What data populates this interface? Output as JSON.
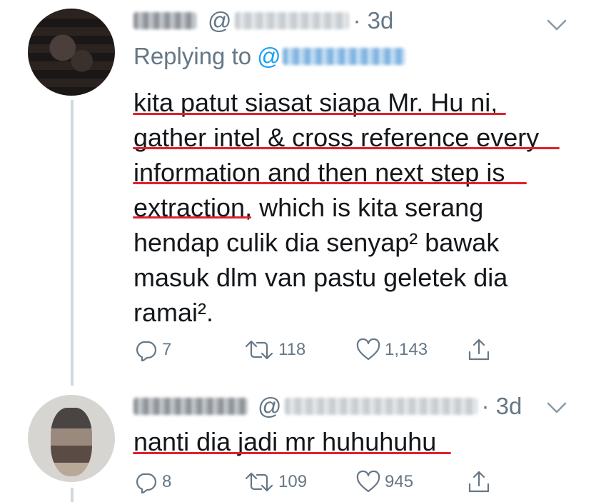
{
  "tweet1": {
    "handle_at": "@",
    "dot_time": "· 3d",
    "replying_label": "Replying to",
    "replying_at": "@",
    "lines": [
      "kita patut siasat siapa Mr. Hu ni,",
      "gather intel & cross reference every",
      "information and then next step is",
      "extraction, which is kita serang",
      "hendap culik dia senyap² bawak",
      "masuk dlm van pastu geletek dia",
      "ramai²."
    ],
    "replies": "7",
    "retweets": "118",
    "likes": "1,143"
  },
  "tweet2": {
    "handle_at": "@",
    "dot_time": "· 3d",
    "lines": [
      "nanti dia jadi mr huhuhuhu"
    ],
    "replies": "8",
    "retweets": "109",
    "likes": "945"
  },
  "icons": [
    "reply-icon",
    "retweet-icon",
    "like-icon",
    "share-icon",
    "chevron-down-icon"
  ],
  "colors": {
    "text": "#14171a",
    "secondary": "#657786",
    "link": "#1da1f2",
    "underline": "#e0212b"
  }
}
